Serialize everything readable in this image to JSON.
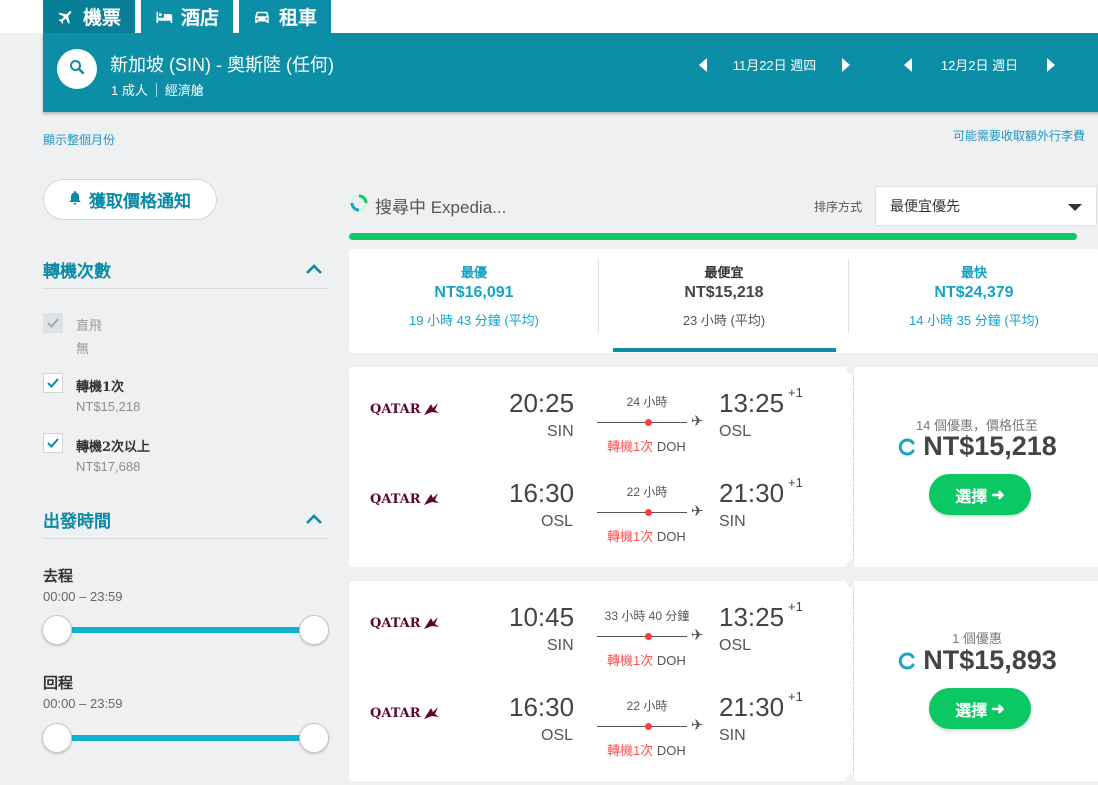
{
  "tabs": [
    {
      "label": "機票",
      "icon": "plane-icon"
    },
    {
      "label": "酒店",
      "icon": "bed-icon"
    },
    {
      "label": "租車",
      "icon": "car-icon"
    }
  ],
  "search": {
    "route": "新加坡 (SIN) - 奧斯陸 (任何)",
    "passengers": "1 成人",
    "cabin": "經濟艙",
    "depart_date": "11月22日 週四",
    "return_date": "12月2日 週日"
  },
  "links": {
    "show_month": "顯示整個月份",
    "baggage_notice": "可能需要收取額外行李費"
  },
  "sidebar": {
    "alert_button": "獲取價格通知",
    "stops": {
      "title": "轉機次數",
      "options": [
        {
          "label": "直飛",
          "sub": "無",
          "checked": true,
          "disabled": true
        },
        {
          "label": "轉機1次",
          "sub": "NT$15,218",
          "checked": true,
          "disabled": false
        },
        {
          "label": "轉機2次以上",
          "sub": "NT$17,688",
          "checked": true,
          "disabled": false
        }
      ]
    },
    "times": {
      "title": "出發時間",
      "outbound_label": "去程",
      "outbound_range": "00:00 – 23:59",
      "return_label": "回程",
      "return_range": "00:00 – 23:59"
    }
  },
  "results_header": {
    "searching": "搜尋中 Expedia...",
    "sort_label": "排序方式",
    "sort_value": "最便宜優先",
    "progress_percent": 100
  },
  "summary": [
    {
      "label": "最優",
      "price": "NT$16,091",
      "duration": "19 小時 43 分鐘 (平均)"
    },
    {
      "label": "最便宜",
      "price": "NT$15,218",
      "duration": "23 小時 (平均)"
    },
    {
      "label": "最快",
      "price": "NT$24,379",
      "duration": "14 小時 35 分鐘 (平均)"
    }
  ],
  "results": [
    {
      "legs": [
        {
          "airline": "QATAR",
          "depart_time": "20:25",
          "depart_code": "SIN",
          "duration": "24 小時",
          "stops": "轉機1次",
          "via": "DOH",
          "arrive_time": "13:25",
          "arrive_plus": "+1",
          "arrive_code": "OSL"
        },
        {
          "airline": "QATAR",
          "depart_time": "16:30",
          "depart_code": "OSL",
          "duration": "22 小時",
          "stops": "轉機1次",
          "via": "DOH",
          "arrive_time": "21:30",
          "arrive_plus": "+1",
          "arrive_code": "SIN"
        }
      ],
      "offers": "14 個優惠，價格低至",
      "price": "NT$15,218",
      "select_label": "選擇"
    },
    {
      "legs": [
        {
          "airline": "QATAR",
          "depart_time": "10:45",
          "depart_code": "SIN",
          "duration": "33 小時 40 分鐘",
          "stops": "轉機1次",
          "via": "DOH",
          "arrive_time": "13:25",
          "arrive_plus": "+1",
          "arrive_code": "OSL"
        },
        {
          "airline": "QATAR",
          "depart_time": "16:30",
          "depart_code": "OSL",
          "duration": "22 小時",
          "stops": "轉機1次",
          "via": "DOH",
          "arrive_time": "21:30",
          "arrive_plus": "+1",
          "arrive_code": "SIN"
        }
      ],
      "offers": "1 個優惠",
      "price": "NT$15,893",
      "select_label": "選擇"
    }
  ],
  "colors": {
    "brand": "#0b8ea6",
    "link": "#2196c4",
    "green": "#0bc865",
    "stop_red": "#ff5454",
    "airline_maroon": "#5c0632"
  }
}
